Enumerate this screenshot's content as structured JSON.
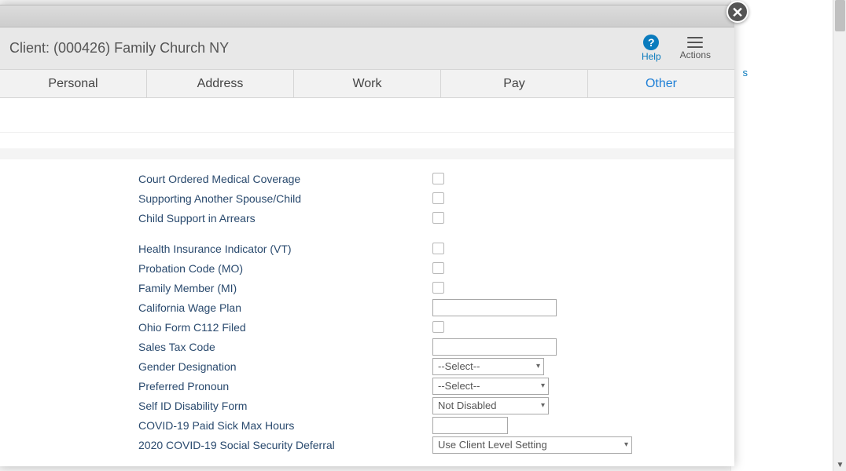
{
  "header": {
    "client_title": "Client: (000426) Family Church NY",
    "help_label": "Help",
    "actions_label": "Actions"
  },
  "tabs": [
    {
      "label": "Personal",
      "active": false
    },
    {
      "label": "Address",
      "active": false
    },
    {
      "label": "Work",
      "active": false
    },
    {
      "label": "Pay",
      "active": false
    },
    {
      "label": "Other",
      "active": true
    }
  ],
  "fields": {
    "court_ordered": "Court Ordered Medical Coverage",
    "supporting": "Supporting Another Spouse/Child",
    "child_support": "Child Support in Arrears",
    "health_ins": "Health Insurance Indicator (VT)",
    "probation": "Probation Code (MO)",
    "family_member": "Family Member (MI)",
    "ca_wage": "California Wage Plan",
    "ohio_c112": "Ohio Form C112 Filed",
    "sales_tax": "Sales Tax Code",
    "gender": "Gender Designation",
    "pronoun": "Preferred Pronoun",
    "disability": "Self ID Disability Form",
    "covid_sick": "COVID-19 Paid Sick Max Hours",
    "covid_deferral": "2020 COVID-19 Social Security Deferral"
  },
  "values": {
    "ca_wage": "",
    "sales_tax": "",
    "gender": "--Select--",
    "pronoun": "--Select--",
    "disability": "Not Disabled",
    "covid_sick": "",
    "covid_deferral": "Use Client Level Setting"
  },
  "bg": {
    "partial_link": "s"
  }
}
